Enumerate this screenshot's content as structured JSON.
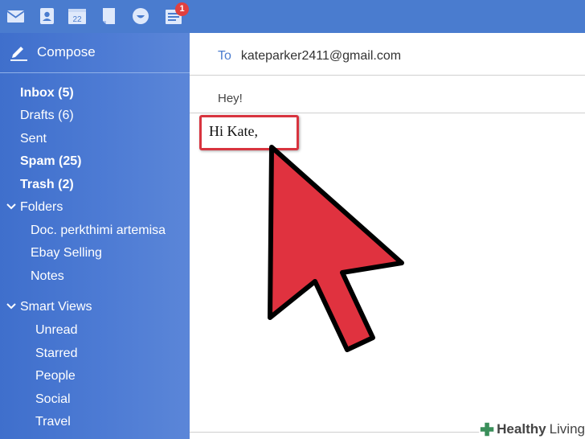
{
  "toolbar": {
    "icons": [
      "mail-icon",
      "contacts-icon",
      "calendar-icon",
      "notepad-icon",
      "messenger-icon",
      "newsfeed-icon"
    ],
    "calendar_day": "22",
    "notification_count": "1"
  },
  "sidebar": {
    "compose_label": "Compose",
    "items": [
      {
        "label": "Inbox (5)",
        "bold": true
      },
      {
        "label": "Drafts (6)",
        "bold": false
      },
      {
        "label": "Sent",
        "bold": false
      },
      {
        "label": "Spam (25)",
        "bold": true
      },
      {
        "label": "Trash (2)",
        "bold": true
      }
    ],
    "folders": {
      "label": "Folders",
      "items": [
        "Doc. perkthimi artemisa",
        "Ebay Selling",
        "Notes"
      ]
    },
    "smart_views": {
      "label": "Smart Views",
      "items": [
        "Unread",
        "Starred",
        "People",
        "Social",
        "Travel"
      ]
    }
  },
  "compose_form": {
    "to_label": "To",
    "to_value": "kateparker2411@gmail.com",
    "subject_value": "Hey!",
    "body_value": "Hi Kate,"
  },
  "watermark": {
    "brand_bold": "Healthy",
    "brand_regular": "Living"
  },
  "colors": {
    "topbar": "#4a7ccf",
    "sidebar": "#4d7bd4",
    "highlight": "#d8343f",
    "arrow_fill": "#e0323f"
  }
}
